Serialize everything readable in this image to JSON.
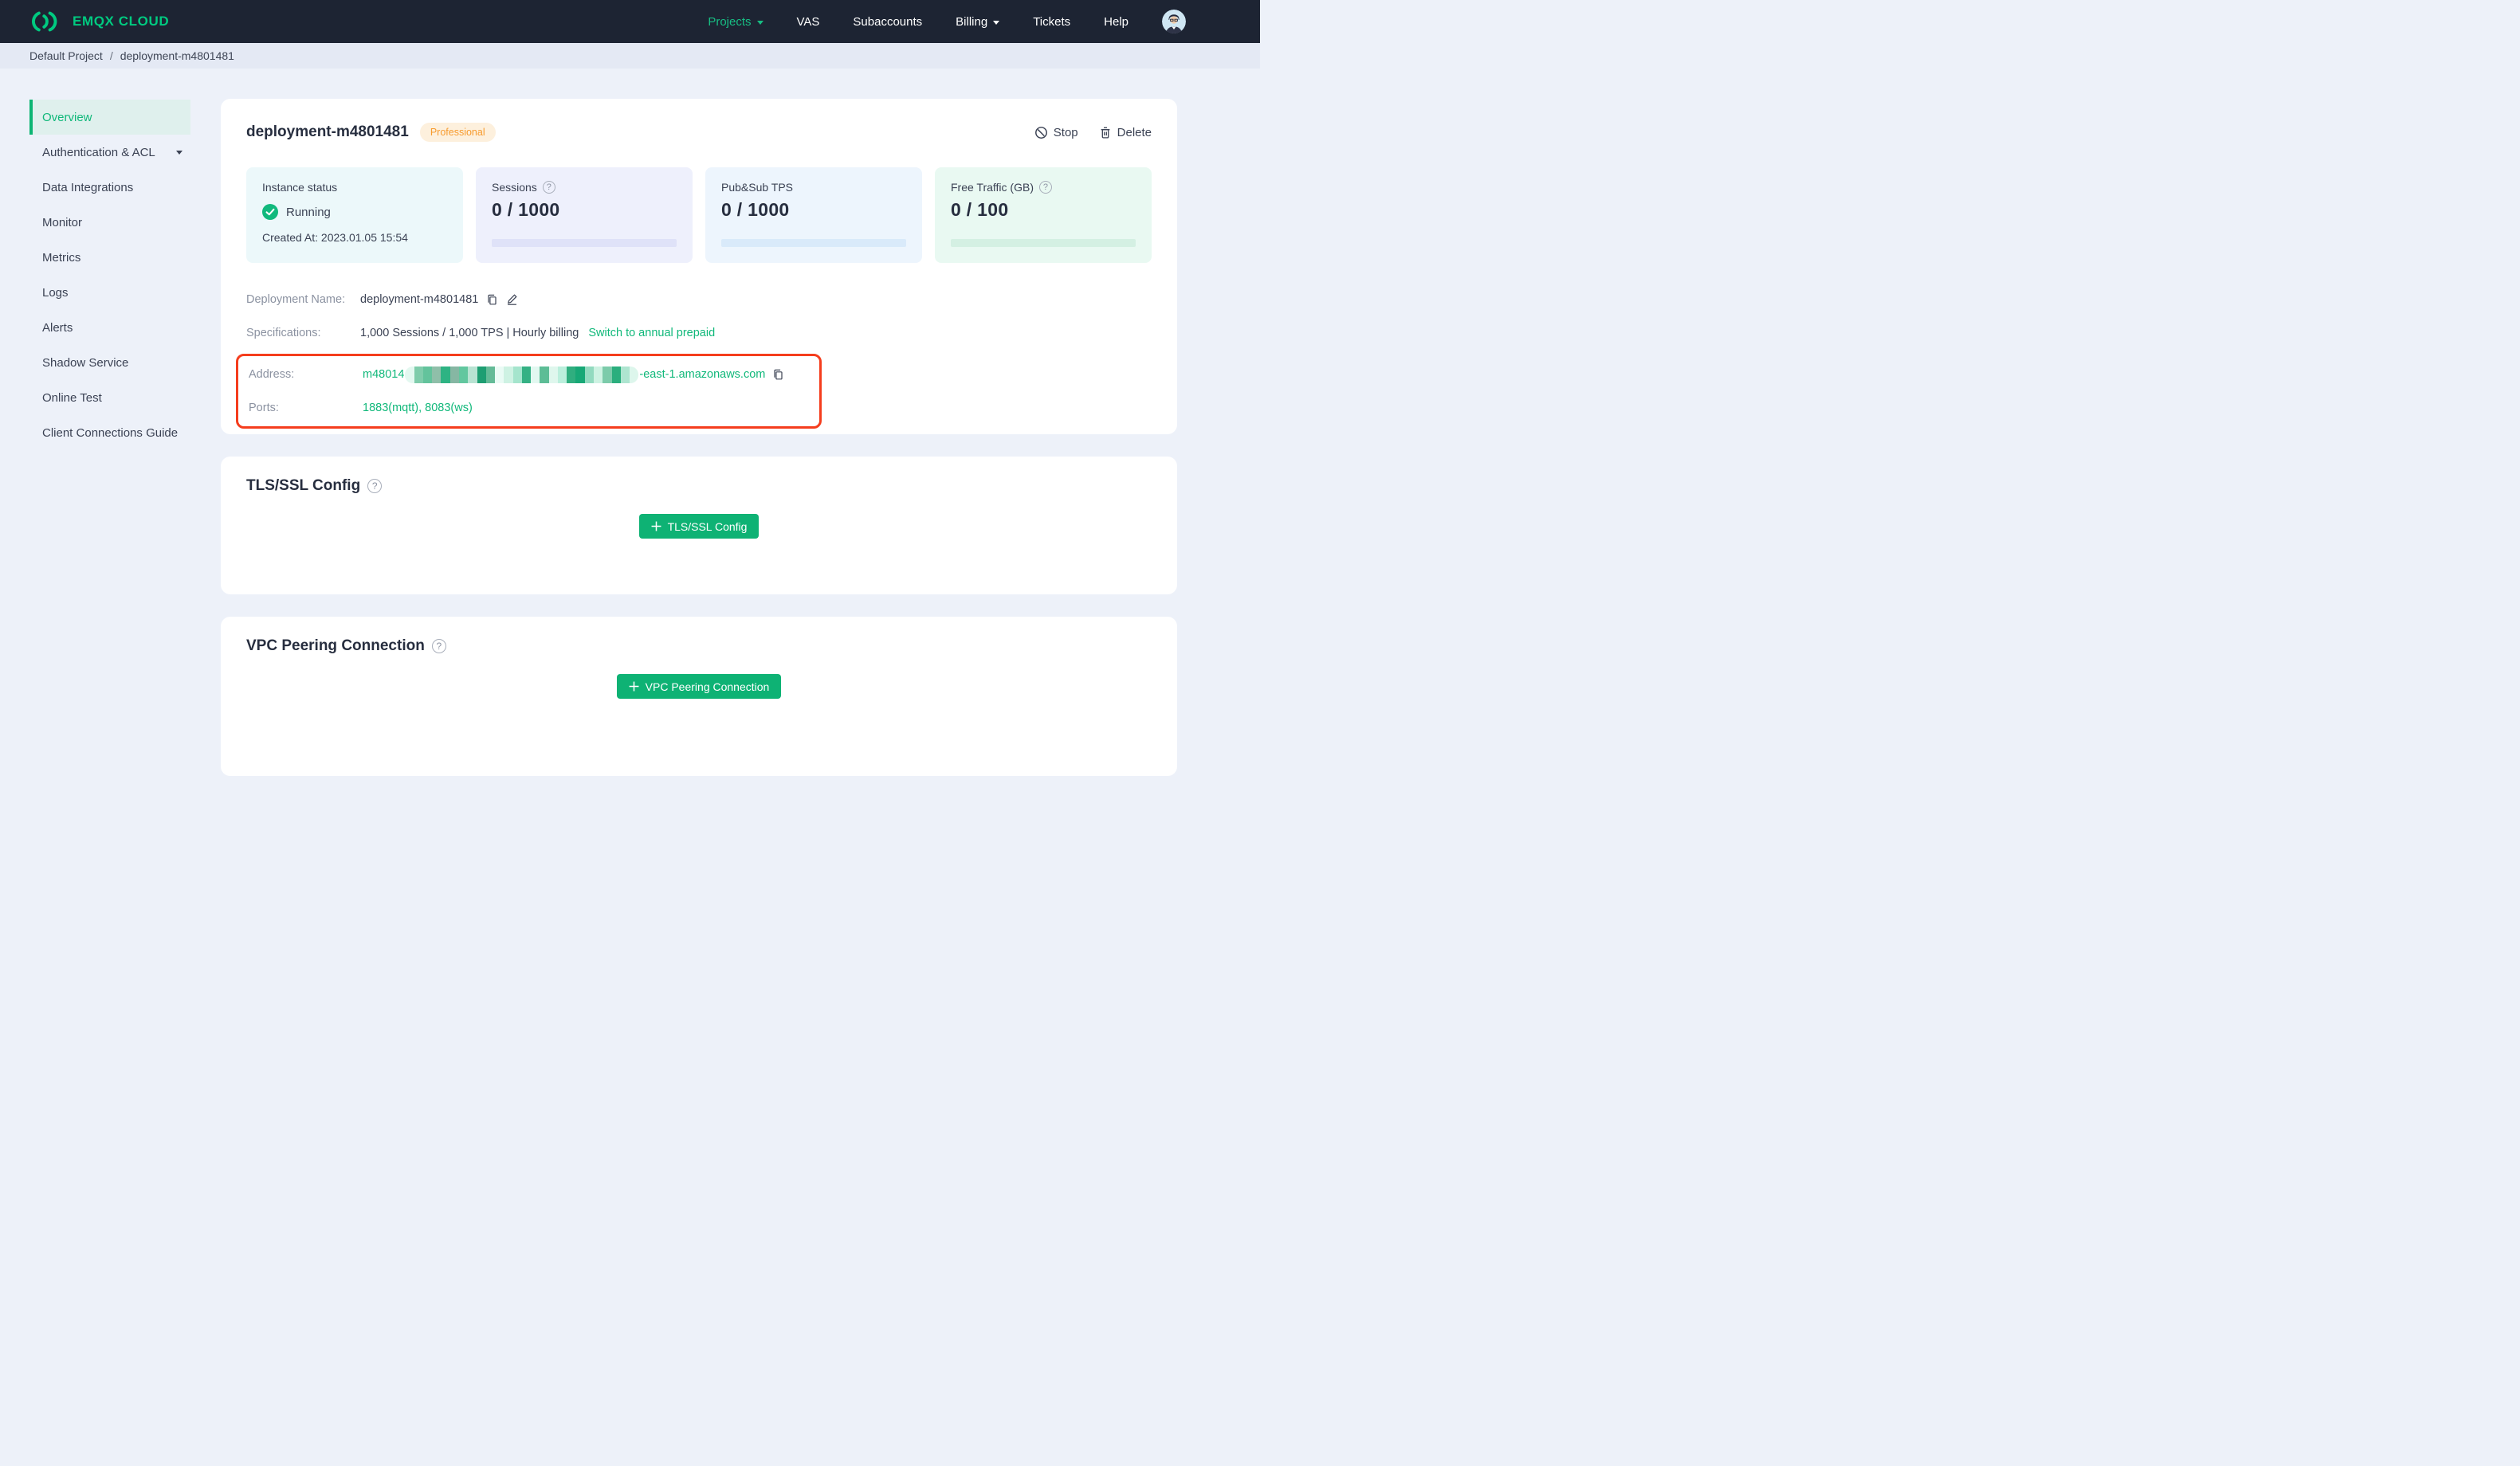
{
  "colors": {
    "accent_green": "#0eb274",
    "link_green": "#10b87a",
    "logo_green": "#00ca80",
    "nav_active_green": "#17bd83",
    "header_bg": "#1d2433",
    "page_bg": "#edf1f9",
    "breadcrumb_bg": "#e4e9f4",
    "badge_bg": "#fdf0dd",
    "badge_text": "#f79b2e",
    "highlight_red": "#f53d1d",
    "running_green": "#11b97d",
    "sidebar_active_bg": "#dff0ed"
  },
  "icons": {
    "help_glyph": "?"
  },
  "header": {
    "logo_text": "EMQX CLOUD",
    "nav": [
      {
        "label": "Projects"
      },
      {
        "label": "VAS"
      },
      {
        "label": "Subaccounts"
      },
      {
        "label": "Billing"
      },
      {
        "label": "Tickets"
      },
      {
        "label": "Help"
      }
    ]
  },
  "breadcrumb": {
    "project": "Default Project",
    "separator": "/",
    "current": "deployment-m4801481"
  },
  "sidebar": {
    "items": [
      "Overview",
      "Authentication & ACL",
      "Data Integrations",
      "Monitor",
      "Metrics",
      "Logs",
      "Alerts",
      "Shadow Service",
      "Online Test",
      "Client Connections Guide"
    ]
  },
  "deployment": {
    "title": "deployment-m4801481",
    "badge": "Professional",
    "stop_label": "Stop",
    "delete_label": "Delete"
  },
  "stats": {
    "instance": {
      "label": "Instance status",
      "status": "Running",
      "created": "Created At: 2023.01.05 15:54",
      "bg": "#ecf8fa"
    },
    "sessions": {
      "label": "Sessions",
      "value": "0 / 1000",
      "bg": "#eef0fc",
      "bar": "#dfe2f8"
    },
    "tps": {
      "label": "Pub&Sub TPS",
      "value": "0 / 1000",
      "bg": "#edf5fd",
      "bar": "#d9eafa"
    },
    "traffic": {
      "label": "Free Traffic (GB)",
      "value": "0 / 100",
      "bg": "#e9f9f2",
      "bar": "#d4f0e3"
    }
  },
  "details": {
    "name_label": "Deployment Name:",
    "name_value": "deployment-m4801481",
    "spec_label": "Specifications:",
    "spec_value": "1,000 Sessions / 1,000 TPS | Hourly billing",
    "spec_link": "Switch to annual prepaid",
    "address_label": "Address:",
    "address_prefix": "m48014",
    "address_suffix": "-east-1.amazonaws.com",
    "address_mosaic": [
      "#e3f8f0",
      "#7fccab",
      "#63c39c",
      "#8fbfa9",
      "#2eb383",
      "#86b7a3",
      "#62c79f",
      "#b8e3d2",
      "#1e9e72",
      "#64bb97",
      "#eafbf5",
      "#cef2e3",
      "#a5e5cd",
      "#35b184",
      "#e2f8f0",
      "#5dbd96",
      "#dff7ed",
      "#bbefdc",
      "#30ae7f",
      "#17a876",
      "#92dabf",
      "#cdf2e2",
      "#7ccbaa",
      "#2bae7d",
      "#aee5d0",
      "#ddf6ec"
    ],
    "ports_label": "Ports:",
    "ports_value": "1883(mqtt), 8083(ws)"
  },
  "tls": {
    "title": "TLS/SSL Config",
    "button_label": "TLS/SSL Config"
  },
  "vpc": {
    "title": "VPC Peering Connection",
    "button_label": "VPC Peering Connection"
  }
}
